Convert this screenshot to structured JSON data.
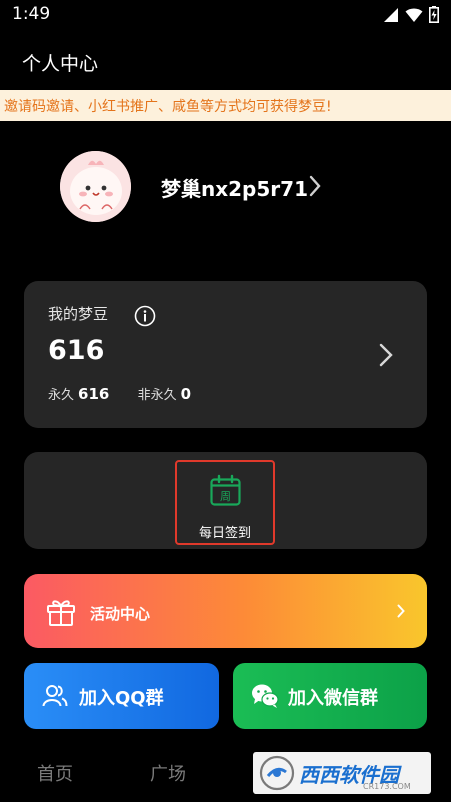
{
  "status_bar": {
    "time": "1:49"
  },
  "header": {
    "title": "个人中心"
  },
  "promo": {
    "text": "邀请码邀请、小红书推广、咸鱼等方式均可获得梦豆!"
  },
  "profile": {
    "username": "梦巢nx2p5r71"
  },
  "points": {
    "label": "我的梦豆",
    "total": "616",
    "permanent_label": "永久",
    "permanent_value": "616",
    "temporary_label": "非永久",
    "temporary_value": "0"
  },
  "checkin": {
    "icon_text": "周",
    "label": "每日签到"
  },
  "activity": {
    "label": "活动中心"
  },
  "groups": {
    "qq_label": "加入QQ群",
    "wechat_label": "加入微信群"
  },
  "bottom_nav": {
    "items": [
      "首页",
      "广场"
    ]
  },
  "watermark": {
    "text": "西西软件园",
    "site": "CR173.COM"
  },
  "colors": {
    "background": "#000000",
    "card": "#262626",
    "promo_bg": "#fdf1dc",
    "promo_text": "#e4741b",
    "checkin_accent": "#19a85a",
    "highlight_border": "#e0392b",
    "qq_blue": "#1f7cec",
    "wechat_green": "#14b04f"
  }
}
